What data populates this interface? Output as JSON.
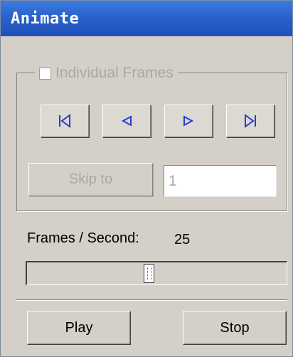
{
  "window": {
    "title": "Animate"
  },
  "individual_frames": {
    "label": "Individual Frames",
    "checked": false,
    "enabled": false
  },
  "navigation": {
    "buttons": [
      {
        "name": "first-frame-button",
        "icon": "skip-to-start-icon"
      },
      {
        "name": "previous-frame-button",
        "icon": "step-back-icon"
      },
      {
        "name": "next-frame-button",
        "icon": "step-forward-icon"
      },
      {
        "name": "last-frame-button",
        "icon": "skip-to-end-icon"
      }
    ]
  },
  "skip": {
    "button_label": "Skip to",
    "frame_value": "1"
  },
  "fps": {
    "label": "Frames / Second:",
    "value": "25",
    "slider_fraction": 0.47
  },
  "actions": {
    "play_label": "Play",
    "stop_label": "Stop"
  },
  "colors": {
    "titlebar": "#2a62cc",
    "face": "#d4d0c8",
    "nav_icon": "#2a3ad0",
    "disabled_text": "#a8a8a8"
  }
}
